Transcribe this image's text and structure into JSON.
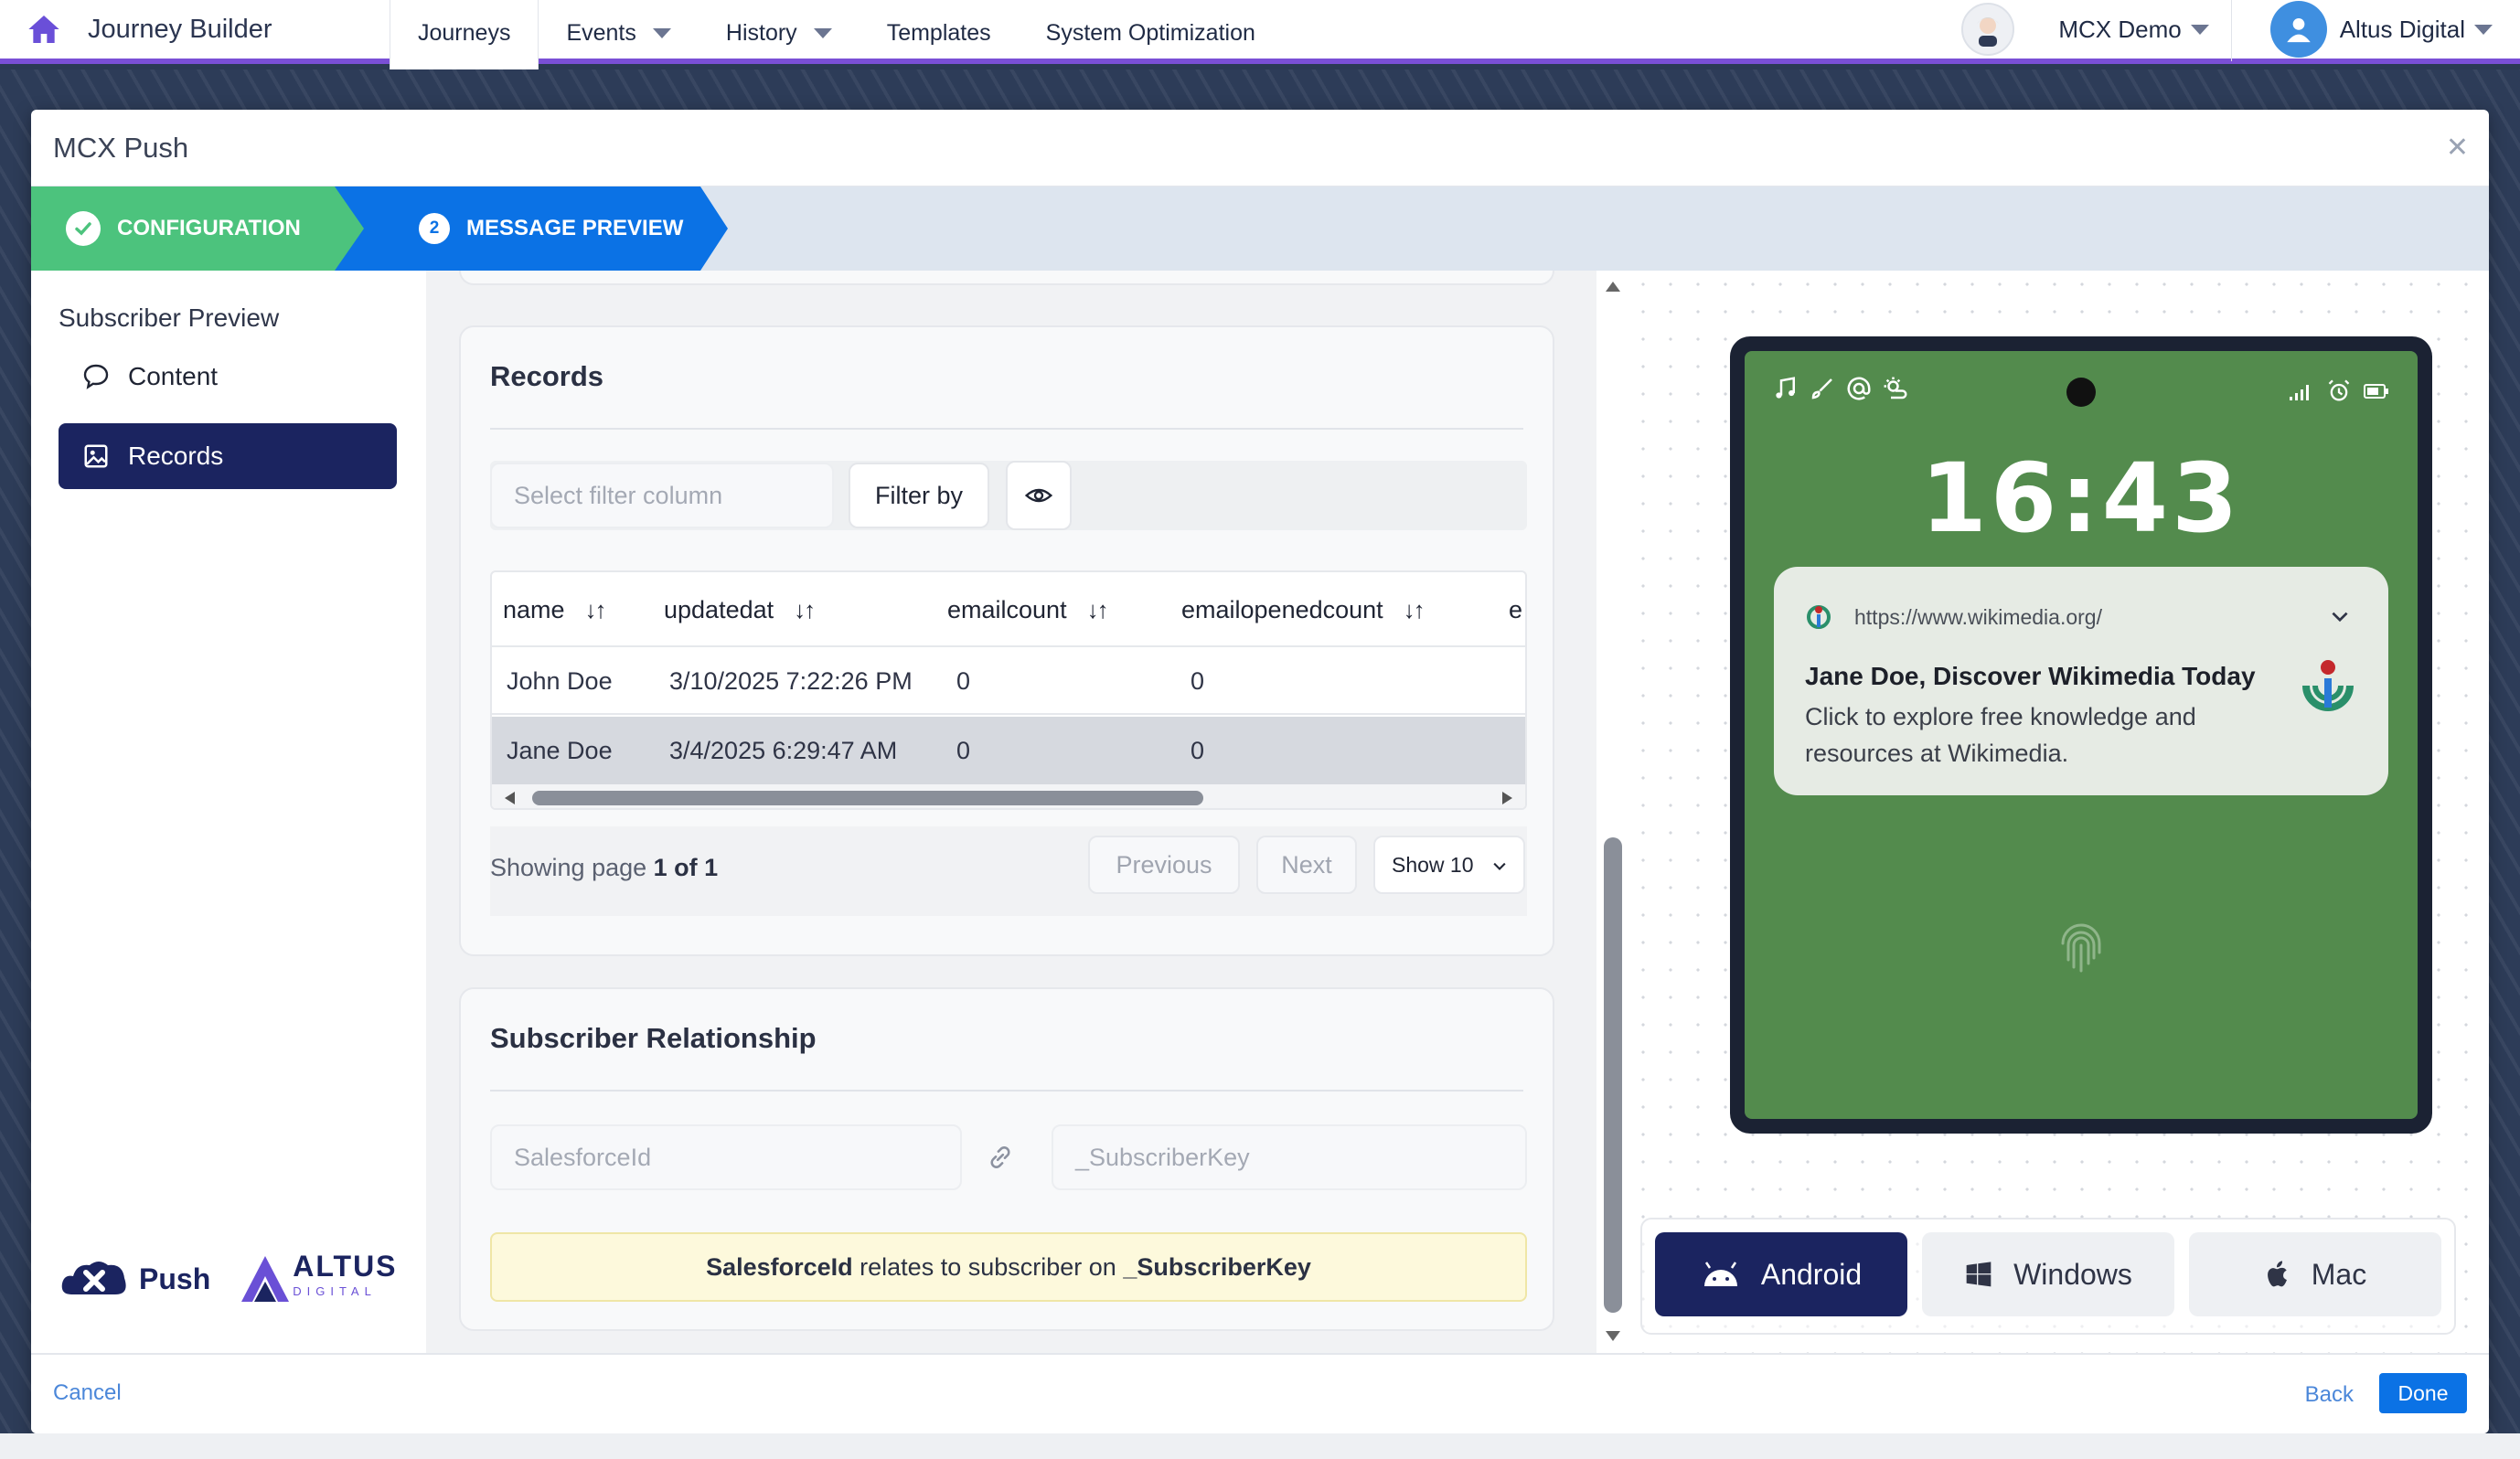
{
  "topnav": {
    "app_title": "Journey Builder",
    "tabs": [
      {
        "label": "Journeys",
        "active": true,
        "dropdown": false
      },
      {
        "label": "Events",
        "active": false,
        "dropdown": true
      },
      {
        "label": "History",
        "active": false,
        "dropdown": true
      },
      {
        "label": "Templates",
        "active": false,
        "dropdown": false
      },
      {
        "label": "System Optimization",
        "active": false,
        "dropdown": false
      }
    ],
    "org_name": "MCX Demo",
    "user_name": "Altus Digital"
  },
  "modal": {
    "title": "MCX Push",
    "close_icon": "close-icon",
    "steps": [
      {
        "label": "CONFIGURATION",
        "state": "complete"
      },
      {
        "number": "2",
        "label": "MESSAGE PREVIEW",
        "state": "current"
      }
    ]
  },
  "sidebar": {
    "heading": "Subscriber Preview",
    "items": [
      {
        "label": "Content",
        "icon": "chat-bubble-icon",
        "active": false
      },
      {
        "label": "Records",
        "icon": "image-icon",
        "active": true
      }
    ],
    "brand": {
      "push_label": "Push",
      "altus_label": "ALTUS",
      "altus_sub": "DIGITAL"
    }
  },
  "records": {
    "title": "Records",
    "filter_placeholder": "Select filter column",
    "filter_button": "Filter by",
    "columns": [
      "name",
      "updatedat",
      "emailcount",
      "emailopenedcount",
      "e"
    ],
    "rows": [
      [
        "John Doe",
        "3/10/2025 7:22:26 PM",
        "0",
        "0"
      ],
      [
        "Jane Doe",
        "3/4/2025 6:29:47 AM",
        "0",
        "0"
      ]
    ],
    "selected_row": 1,
    "pager": {
      "showing_prefix": "Showing page ",
      "showing_page": "1 of 1",
      "previous": "Previous",
      "next": "Next",
      "page_size": "Show 10"
    }
  },
  "relationship": {
    "title": "Subscriber Relationship",
    "left_field": "SalesforceId",
    "right_field": "_SubscriberKey",
    "note_left": "SalesforceId",
    "note_middle": " relates to subscriber on ",
    "note_right": "_SubscriberKey"
  },
  "preview": {
    "time": "16:43",
    "notification": {
      "url": "https://www.wikimedia.org/",
      "title": "Jane Doe, Discover Wikimedia Today",
      "body": "Click to explore free knowledge and resources at Wikimedia."
    },
    "os_tabs": [
      {
        "label": "Android",
        "icon": "android-icon",
        "active": true
      },
      {
        "label": "Windows",
        "icon": "windows-icon",
        "active": false
      },
      {
        "label": "Mac",
        "icon": "apple-icon",
        "active": false
      }
    ]
  },
  "footer": {
    "cancel": "Cancel",
    "back": "Back",
    "done": "Done"
  },
  "colors": {
    "nav_accent": "#7a4fd6",
    "step_complete": "#4cc37d",
    "step_current": "#0b72e5",
    "active_nav": "#1b2460",
    "phone_screen": "#538b4d"
  }
}
